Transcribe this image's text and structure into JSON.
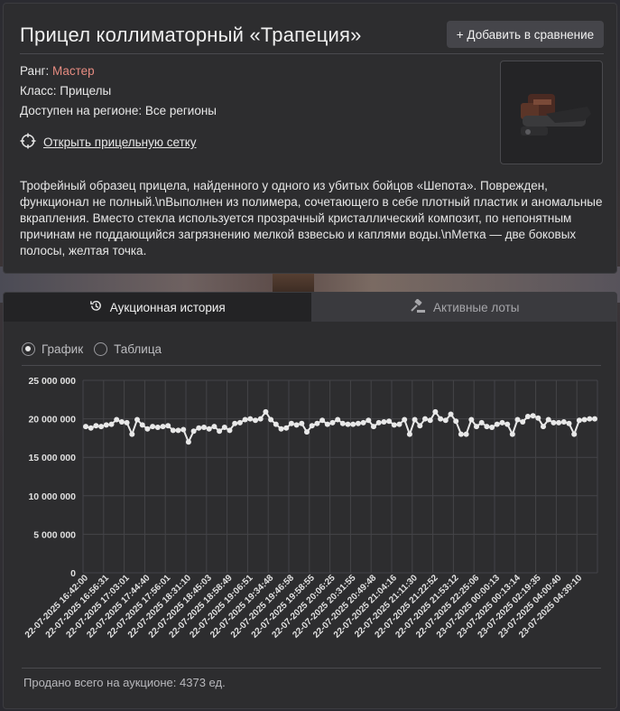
{
  "item": {
    "title": "Прицел коллиматорный «Трапеция»",
    "compare_label": "+ Добавить в сравнение",
    "rank_label": "Ранг: ",
    "rank_value": "Мастер",
    "rank_color": "#e58b80",
    "class_line": "Класс: Прицелы",
    "region_line": "Доступен на регионе: Все регионы",
    "reticle_link": "Открыть прицельную сетку",
    "reticle_icon": "crosshair-icon",
    "description": "Трофейный образец прицела, найденного у одного из убитых бойцов «Шепота». Поврежден, функционал не полный.\\nВыполнен из полимера, сочетающего в себе плотный пластик и аномальные вкрапления. Вместо стекла используется прозрачный кристаллический композит, по непонятным причинам не поддающийся загрязнению мелкой взвесью и каплями воды.\\nМетка — две боковых полосы, желтая точка."
  },
  "tabs": [
    {
      "label": "Аукционная история",
      "icon": "history-icon",
      "active": true
    },
    {
      "label": "Активные лоты",
      "icon": "gavel-icon",
      "active": false
    }
  ],
  "view_options": [
    {
      "label": "График",
      "selected": true
    },
    {
      "label": "Таблица",
      "selected": false
    }
  ],
  "footer": {
    "sold_text": "Продано всего на аукционе: 4373 ед."
  },
  "chart_data": {
    "type": "line",
    "ylim": [
      0,
      25000000
    ],
    "yticks": [
      "25 000 000",
      "20 000 000",
      "15 000 000",
      "10 000 000",
      "5 000 000",
      "0"
    ],
    "ytick_values": [
      25000000,
      20000000,
      15000000,
      10000000,
      5000000,
      0
    ],
    "xticks": [
      "22-07-2025 16:42:00",
      "22-07-2025 16:56:31",
      "22-07-2025 17:03:01",
      "22-07-2025 17:44:40",
      "22-07-2025 17:56:01",
      "22-07-2025 18:31:10",
      "22-07-2025 18:45:03",
      "22-07-2025 18:58:49",
      "22-07-2025 19:06:51",
      "22-07-2025 19:34:48",
      "22-07-2025 19:46:58",
      "22-07-2025 19:58:55",
      "22-07-2025 20:06:25",
      "22-07-2025 20:31:55",
      "22-07-2025 20:49:48",
      "22-07-2025 21:04:16",
      "22-07-2025 21:11:30",
      "22-07-2025 21:22:52",
      "22-07-2025 21:53:12",
      "22-07-2025 22:25:06",
      "23-07-2025 00:00:13",
      "23-07-2025 00:13:14",
      "23-07-2025 02:19:35",
      "23-07-2025 04:00:40",
      "23-07-2025 04:39:10"
    ],
    "grid": true,
    "line_color": "#e8e8e8",
    "values": [
      19000000,
      18800000,
      19100000,
      19000000,
      19200000,
      19300000,
      19900000,
      19600000,
      19500000,
      18000000,
      19900000,
      19200000,
      18700000,
      19000000,
      18900000,
      19000000,
      19100000,
      18500000,
      18500000,
      18600000,
      17000000,
      18400000,
      18800000,
      18900000,
      18700000,
      19000000,
      18400000,
      18900000,
      18500000,
      19400000,
      19500000,
      19900000,
      20000000,
      19800000,
      20000000,
      20900000,
      19900000,
      19300000,
      18700000,
      18800000,
      19400000,
      19200000,
      19400000,
      18300000,
      19100000,
      19400000,
      19800000,
      19300000,
      19500000,
      19900000,
      19400000,
      19300000,
      19300000,
      19400000,
      19500000,
      19800000,
      19000000,
      19500000,
      19600000,
      19700000,
      19200000,
      19300000,
      19900000,
      18000000,
      19900000,
      19100000,
      20000000,
      19800000,
      20900000,
      20000000,
      19800000,
      20600000,
      19700000,
      18000000,
      18000000,
      19900000,
      19000000,
      19500000,
      19000000,
      18900000,
      19300000,
      19500000,
      19300000,
      18000000,
      19900000,
      19600000,
      20300000,
      20400000,
      20100000,
      19000000,
      19900000,
      19500000,
      19500000,
      19600000,
      19400000,
      18000000,
      19800000,
      19900000,
      20000000,
      20000000
    ]
  }
}
